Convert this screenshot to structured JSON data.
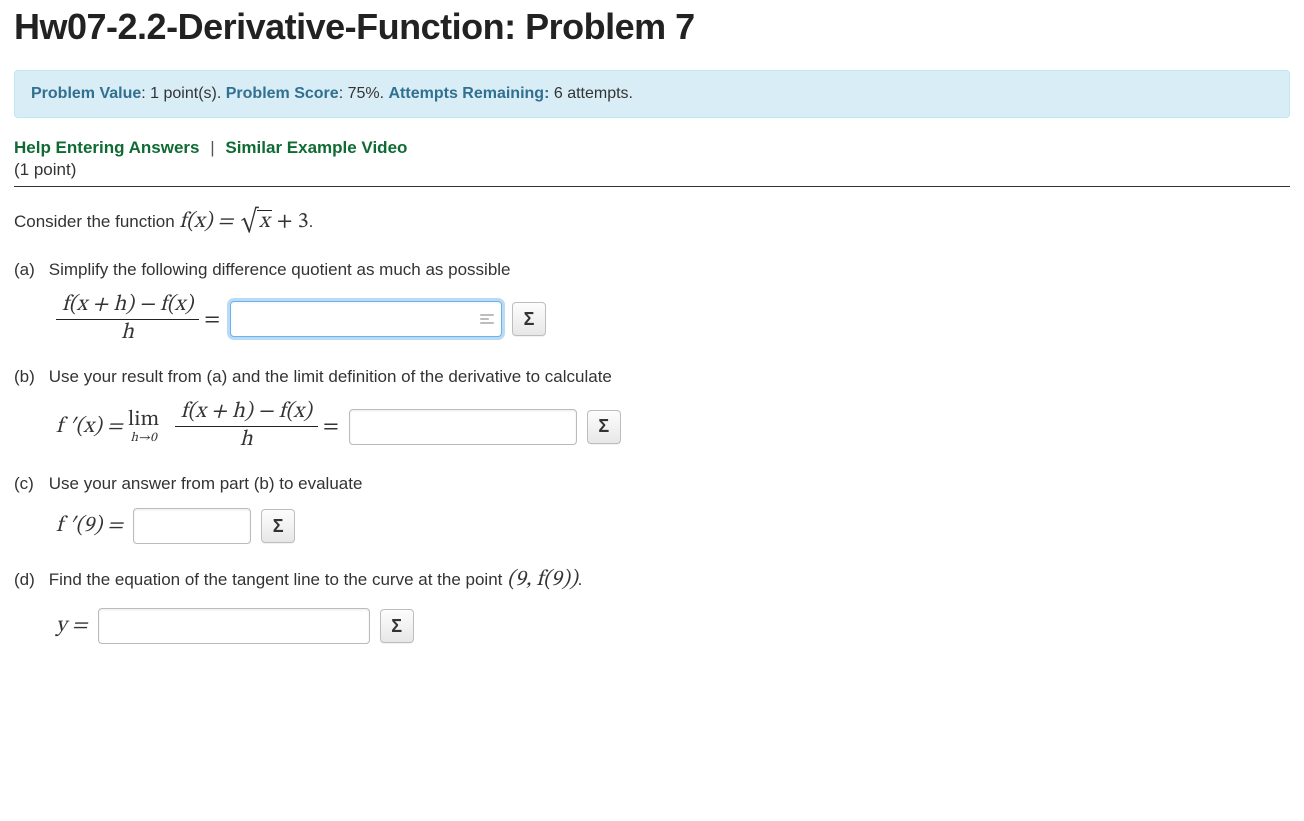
{
  "title": "Hw07-2.2-Derivative-Function: Problem 7",
  "info": {
    "value_label": "Problem Value",
    "value_text": ": 1 point(s). ",
    "score_label": "Problem Score",
    "score_text": ": 75%. ",
    "attempts_label": "Attempts Remaining:",
    "attempts_text": " 6 attempts."
  },
  "links": {
    "help": "Help Entering Answers",
    "sep": "|",
    "video": "Similar Example Video"
  },
  "onepoint": "(1 point)",
  "stem_a": "Consider the function ",
  "stem_b": ".",
  "fn_lhs": "f(x) = ",
  "fn_radicand": "x",
  "fn_tail": " + 3",
  "parts": {
    "a": {
      "label": "(a)",
      "text": "Simplify the following difference quotient as much as possible"
    },
    "b": {
      "label": "(b)",
      "text": "Use your result from (a) and the limit definition of the derivative to calculate"
    },
    "c": {
      "label": "(c)",
      "text": "Use your answer from part (b) to evaluate"
    },
    "d": {
      "label": "(d)",
      "text_pre": "Find the equation of the tangent line to the curve at the point ",
      "point": "(9, f(9))",
      "text_post": "."
    }
  },
  "math": {
    "dq_num": "f(x + h) − f(x)",
    "dq_den": "h",
    "eq": " = ",
    "fprime_x": "f ′(x) = ",
    "lim_top": "lim",
    "lim_bot": "h→0",
    "fprime_9": "f ′(9) = ",
    "y_eq": "y = "
  },
  "sigma": "Σ",
  "inputs": {
    "a": "",
    "b": "",
    "c": "",
    "d": ""
  }
}
